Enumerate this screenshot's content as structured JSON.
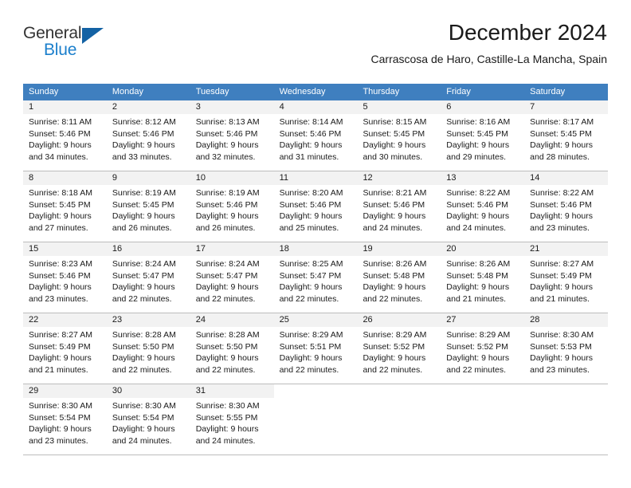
{
  "brand": {
    "word_one": "General",
    "word_two": "Blue",
    "logo_icon": "triangle-logo-icon",
    "color_primary": "#1362a4",
    "color_accent": "#1b7fcc"
  },
  "header": {
    "title": "December 2024",
    "subtitle": "Carrascosa de Haro, Castille-La Mancha, Spain"
  },
  "calendar": {
    "header_bg": "#3f7fbf",
    "daynum_bg": "#f2f2f2",
    "weekdays": [
      "Sunday",
      "Monday",
      "Tuesday",
      "Wednesday",
      "Thursday",
      "Friday",
      "Saturday"
    ],
    "weeks": [
      [
        {
          "day": "1",
          "sunrise": "Sunrise: 8:11 AM",
          "sunset": "Sunset: 5:46 PM",
          "daylight_1": "Daylight: 9 hours",
          "daylight_2": "and 34 minutes."
        },
        {
          "day": "2",
          "sunrise": "Sunrise: 8:12 AM",
          "sunset": "Sunset: 5:46 PM",
          "daylight_1": "Daylight: 9 hours",
          "daylight_2": "and 33 minutes."
        },
        {
          "day": "3",
          "sunrise": "Sunrise: 8:13 AM",
          "sunset": "Sunset: 5:46 PM",
          "daylight_1": "Daylight: 9 hours",
          "daylight_2": "and 32 minutes."
        },
        {
          "day": "4",
          "sunrise": "Sunrise: 8:14 AM",
          "sunset": "Sunset: 5:46 PM",
          "daylight_1": "Daylight: 9 hours",
          "daylight_2": "and 31 minutes."
        },
        {
          "day": "5",
          "sunrise": "Sunrise: 8:15 AM",
          "sunset": "Sunset: 5:45 PM",
          "daylight_1": "Daylight: 9 hours",
          "daylight_2": "and 30 minutes."
        },
        {
          "day": "6",
          "sunrise": "Sunrise: 8:16 AM",
          "sunset": "Sunset: 5:45 PM",
          "daylight_1": "Daylight: 9 hours",
          "daylight_2": "and 29 minutes."
        },
        {
          "day": "7",
          "sunrise": "Sunrise: 8:17 AM",
          "sunset": "Sunset: 5:45 PM",
          "daylight_1": "Daylight: 9 hours",
          "daylight_2": "and 28 minutes."
        }
      ],
      [
        {
          "day": "8",
          "sunrise": "Sunrise: 8:18 AM",
          "sunset": "Sunset: 5:45 PM",
          "daylight_1": "Daylight: 9 hours",
          "daylight_2": "and 27 minutes."
        },
        {
          "day": "9",
          "sunrise": "Sunrise: 8:19 AM",
          "sunset": "Sunset: 5:45 PM",
          "daylight_1": "Daylight: 9 hours",
          "daylight_2": "and 26 minutes."
        },
        {
          "day": "10",
          "sunrise": "Sunrise: 8:19 AM",
          "sunset": "Sunset: 5:46 PM",
          "daylight_1": "Daylight: 9 hours",
          "daylight_2": "and 26 minutes."
        },
        {
          "day": "11",
          "sunrise": "Sunrise: 8:20 AM",
          "sunset": "Sunset: 5:46 PM",
          "daylight_1": "Daylight: 9 hours",
          "daylight_2": "and 25 minutes."
        },
        {
          "day": "12",
          "sunrise": "Sunrise: 8:21 AM",
          "sunset": "Sunset: 5:46 PM",
          "daylight_1": "Daylight: 9 hours",
          "daylight_2": "and 24 minutes."
        },
        {
          "day": "13",
          "sunrise": "Sunrise: 8:22 AM",
          "sunset": "Sunset: 5:46 PM",
          "daylight_1": "Daylight: 9 hours",
          "daylight_2": "and 24 minutes."
        },
        {
          "day": "14",
          "sunrise": "Sunrise: 8:22 AM",
          "sunset": "Sunset: 5:46 PM",
          "daylight_1": "Daylight: 9 hours",
          "daylight_2": "and 23 minutes."
        }
      ],
      [
        {
          "day": "15",
          "sunrise": "Sunrise: 8:23 AM",
          "sunset": "Sunset: 5:46 PM",
          "daylight_1": "Daylight: 9 hours",
          "daylight_2": "and 23 minutes."
        },
        {
          "day": "16",
          "sunrise": "Sunrise: 8:24 AM",
          "sunset": "Sunset: 5:47 PM",
          "daylight_1": "Daylight: 9 hours",
          "daylight_2": "and 22 minutes."
        },
        {
          "day": "17",
          "sunrise": "Sunrise: 8:24 AM",
          "sunset": "Sunset: 5:47 PM",
          "daylight_1": "Daylight: 9 hours",
          "daylight_2": "and 22 minutes."
        },
        {
          "day": "18",
          "sunrise": "Sunrise: 8:25 AM",
          "sunset": "Sunset: 5:47 PM",
          "daylight_1": "Daylight: 9 hours",
          "daylight_2": "and 22 minutes."
        },
        {
          "day": "19",
          "sunrise": "Sunrise: 8:26 AM",
          "sunset": "Sunset: 5:48 PM",
          "daylight_1": "Daylight: 9 hours",
          "daylight_2": "and 22 minutes."
        },
        {
          "day": "20",
          "sunrise": "Sunrise: 8:26 AM",
          "sunset": "Sunset: 5:48 PM",
          "daylight_1": "Daylight: 9 hours",
          "daylight_2": "and 21 minutes."
        },
        {
          "day": "21",
          "sunrise": "Sunrise: 8:27 AM",
          "sunset": "Sunset: 5:49 PM",
          "daylight_1": "Daylight: 9 hours",
          "daylight_2": "and 21 minutes."
        }
      ],
      [
        {
          "day": "22",
          "sunrise": "Sunrise: 8:27 AM",
          "sunset": "Sunset: 5:49 PM",
          "daylight_1": "Daylight: 9 hours",
          "daylight_2": "and 21 minutes."
        },
        {
          "day": "23",
          "sunrise": "Sunrise: 8:28 AM",
          "sunset": "Sunset: 5:50 PM",
          "daylight_1": "Daylight: 9 hours",
          "daylight_2": "and 22 minutes."
        },
        {
          "day": "24",
          "sunrise": "Sunrise: 8:28 AM",
          "sunset": "Sunset: 5:50 PM",
          "daylight_1": "Daylight: 9 hours",
          "daylight_2": "and 22 minutes."
        },
        {
          "day": "25",
          "sunrise": "Sunrise: 8:29 AM",
          "sunset": "Sunset: 5:51 PM",
          "daylight_1": "Daylight: 9 hours",
          "daylight_2": "and 22 minutes."
        },
        {
          "day": "26",
          "sunrise": "Sunrise: 8:29 AM",
          "sunset": "Sunset: 5:52 PM",
          "daylight_1": "Daylight: 9 hours",
          "daylight_2": "and 22 minutes."
        },
        {
          "day": "27",
          "sunrise": "Sunrise: 8:29 AM",
          "sunset": "Sunset: 5:52 PM",
          "daylight_1": "Daylight: 9 hours",
          "daylight_2": "and 22 minutes."
        },
        {
          "day": "28",
          "sunrise": "Sunrise: 8:30 AM",
          "sunset": "Sunset: 5:53 PM",
          "daylight_1": "Daylight: 9 hours",
          "daylight_2": "and 23 minutes."
        }
      ],
      [
        {
          "day": "29",
          "sunrise": "Sunrise: 8:30 AM",
          "sunset": "Sunset: 5:54 PM",
          "daylight_1": "Daylight: 9 hours",
          "daylight_2": "and 23 minutes."
        },
        {
          "day": "30",
          "sunrise": "Sunrise: 8:30 AM",
          "sunset": "Sunset: 5:54 PM",
          "daylight_1": "Daylight: 9 hours",
          "daylight_2": "and 24 minutes."
        },
        {
          "day": "31",
          "sunrise": "Sunrise: 8:30 AM",
          "sunset": "Sunset: 5:55 PM",
          "daylight_1": "Daylight: 9 hours",
          "daylight_2": "and 24 minutes."
        },
        {
          "day": "",
          "sunrise": "",
          "sunset": "",
          "daylight_1": "",
          "daylight_2": ""
        },
        {
          "day": "",
          "sunrise": "",
          "sunset": "",
          "daylight_1": "",
          "daylight_2": ""
        },
        {
          "day": "",
          "sunrise": "",
          "sunset": "",
          "daylight_1": "",
          "daylight_2": ""
        },
        {
          "day": "",
          "sunrise": "",
          "sunset": "",
          "daylight_1": "",
          "daylight_2": ""
        }
      ]
    ]
  }
}
